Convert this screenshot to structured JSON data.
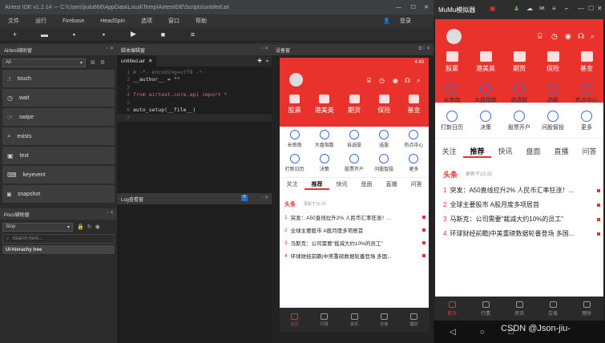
{
  "ide": {
    "title": "Airtest IDE v1.2.14 --- C:\\Users\\jiulu666\\AppData\\Local\\Temp\\AirtestIDE\\Scripts\\untitled.air",
    "menu": [
      "文件",
      "运行",
      "Firebase",
      "HeadSpin",
      "选项",
      "窗口",
      "帮助"
    ],
    "login": "登录",
    "toolbar_icons": [
      "new-icon",
      "open-icon",
      "save-icon",
      "save-as-icon",
      "run-icon",
      "stop-icon",
      "log-icon"
    ],
    "airtest_panel": {
      "title": "Airtest辅助窗",
      "filter": "All",
      "apis": [
        {
          "label": "touch",
          "icon": "hand-icon"
        },
        {
          "label": "wait",
          "icon": "clock-icon"
        },
        {
          "label": "swipe",
          "icon": "swipe-icon"
        },
        {
          "label": "exists",
          "icon": "magnifier-icon"
        },
        {
          "label": "text",
          "icon": "text-icon"
        },
        {
          "label": "keyevent",
          "icon": "keyboard-icon"
        },
        {
          "label": "snapshot",
          "icon": "camera-icon"
        }
      ]
    },
    "poco_panel": {
      "title": "Poco辅助窗",
      "mode": "Stop",
      "search_placeholder": "Search here...",
      "tree_item": "UI-hierachy tree"
    },
    "editor": {
      "title": "脚本编辑窗",
      "tab": "untitled.air",
      "lines": [
        {
          "n": "1",
          "t": "# -*- encoding=utf8 -*-"
        },
        {
          "n": "2",
          "t": "__author__ = \"\""
        },
        {
          "n": "3",
          "t": ""
        },
        {
          "n": "4",
          "t": "from airtest.core.api import *"
        },
        {
          "n": "5",
          "t": ""
        },
        {
          "n": "6",
          "t": "auto_setup(__file__)"
        },
        {
          "n": "7",
          "t": ""
        }
      ]
    },
    "log_panel": {
      "title": "Log查看窗"
    },
    "device_panel": {
      "title": "设备窗"
    }
  },
  "mumu": {
    "title": "MuMu模拟器",
    "time": "4:43"
  },
  "app": {
    "top_icons": [
      "股票",
      "港美英",
      "期货",
      "保险",
      "基金"
    ],
    "grid": [
      [
        "长审南",
        "大盘指数",
        "自选股",
        "选股",
        "热点中心"
      ],
      [
        "打新日历",
        "决策",
        "股票开户",
        "问股智投",
        "更多"
      ]
    ],
    "tabs": [
      "关注",
      "推荐",
      "快讯",
      "盘面",
      "直播",
      "问答"
    ],
    "headline_label": "头条",
    "headline_time": "更新于15:32",
    "news": [
      {
        "num": "1",
        "text": "突发：A50直线拉升2% 人民币汇率狂涨！..."
      },
      {
        "num": "2",
        "text": "全球主要股市 A股月度多项居首"
      },
      {
        "num": "3",
        "text": "马斯克：公司需要\"裁减大约10%的员工\""
      },
      {
        "num": "4",
        "text": "环球财经前瞻|中美重磅数据轮番登场 多国..."
      }
    ],
    "bottom_nav": [
      "首页",
      "行情",
      "资讯",
      "交易",
      "理财"
    ]
  },
  "watermark": "CSDN @Json-jiu-"
}
